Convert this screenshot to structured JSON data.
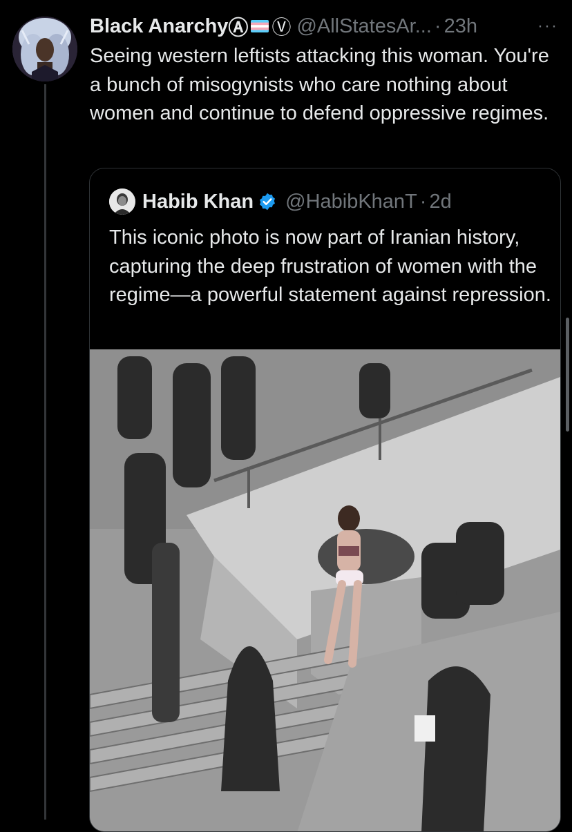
{
  "tweet": {
    "display_name": "Black Anarchy",
    "anarchy_symbol": "Ⓐ",
    "v_symbol": "Ⓥ",
    "handle": "@AllStatesAr...",
    "separator": "·",
    "time": "23h",
    "more_icon": "···",
    "text": "Seeing western leftists attacking this woman. You're a bunch of misogynists who care nothing about women and continue to defend oppressive regimes."
  },
  "quoted_tweet": {
    "display_name": "Habib Khan",
    "handle": "@HabibKhanT",
    "separator": "·",
    "time": "2d",
    "text": "This iconic photo is now part of Iranian history, capturing the deep frustration of women with the regime—a powerful statement against repression."
  },
  "colors": {
    "background": "#000000",
    "text_primary": "#e7e9ea",
    "text_secondary": "#71767b",
    "verified_blue": "#1d9bf0",
    "border": "#2f3336"
  }
}
